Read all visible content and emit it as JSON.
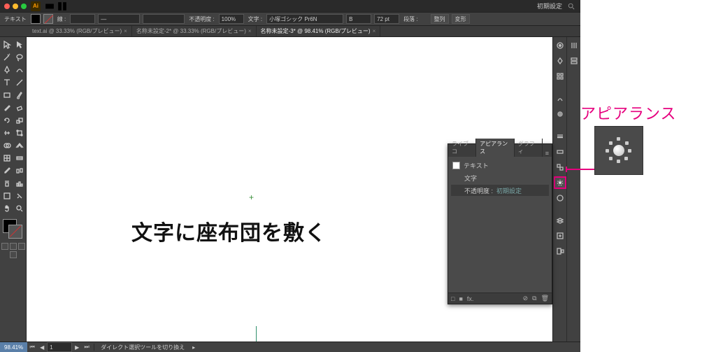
{
  "titlebar": {
    "app_abbrev": "Ai",
    "preset_label": "初期設定"
  },
  "controlbar": {
    "mode_label": "テキスト",
    "stroke_label": "線 :",
    "stroke_dash": "—",
    "opacity_label": "不透明度 :",
    "opacity_value": "100%",
    "font_label": "文字 :",
    "font_value": "小塚ゴシック Pr6N",
    "font_weight": "B",
    "font_size": "72 pt",
    "para_label": "段落 :",
    "align_label": "整列",
    "trans_label": "変形"
  },
  "tabs": [
    {
      "label": "text.ai @ 33.33% (RGB/プレビュー)"
    },
    {
      "label": "名称未設定-2* @ 33.33% (RGB/プレビュー)"
    },
    {
      "label": "名称未設定-3* @ 98.41% (RGB/プレビュー)"
    }
  ],
  "canvas": {
    "main_text": "文字に座布団を敷く"
  },
  "panel": {
    "tab_live": "ライブコ",
    "tab_appearance": "アピアランス",
    "tab_graphic": "グラフィ",
    "row_text": "テキスト",
    "row_char": "文字",
    "row_opacity_label": "不透明度 :",
    "row_opacity_value": "初期設定",
    "footer_fx": "fx."
  },
  "status": {
    "zoom": "98.41%",
    "tool_hint": "ダイレクト選択ツールを切り換え"
  },
  "callout": {
    "label": "アピアランス"
  }
}
